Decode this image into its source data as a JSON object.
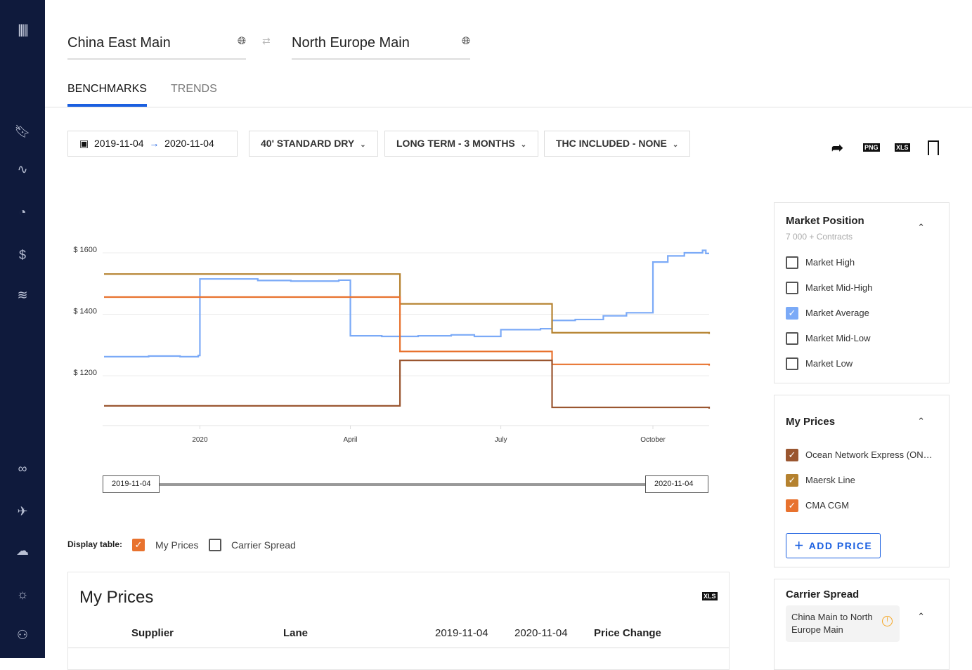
{
  "sidebar": {
    "icons": [
      "logo-icon",
      "bookmark-icon",
      "activity-icon",
      "speedometer-icon",
      "money-icon",
      "layers-icon",
      "incognito-icon",
      "plane-icon",
      "cloud-upload-icon",
      "lightbulb-icon",
      "user-icon"
    ]
  },
  "lanes": {
    "origin": "China East Main",
    "destination": "North Europe Main"
  },
  "tabs": [
    {
      "label": "BENCHMARKS",
      "active": true
    },
    {
      "label": "TRENDS",
      "active": false
    }
  ],
  "filters": {
    "date_from": "2019-11-04",
    "date_to": "2020-11-04",
    "container": "40' STANDARD DRY",
    "term": "LONG TERM - 3 MONTHS",
    "thc": "THC INCLUDED - NONE"
  },
  "tools": {
    "png": "PNG",
    "xls": "XLS"
  },
  "chart_data": {
    "type": "line",
    "step": true,
    "xlim": [
      "2019-11-04",
      "2020-11-04"
    ],
    "ylim": [
      1036,
      1640
    ],
    "yticks": [
      {
        "v": 1600,
        "label": "$ 1600"
      },
      {
        "v": 1400,
        "label": "$ 1400"
      },
      {
        "v": 1200,
        "label": "$ 1200"
      }
    ],
    "xticks": [
      {
        "d": "2020-01-01",
        "label": "2020"
      },
      {
        "d": "2020-04-01",
        "label": "April"
      },
      {
        "d": "2020-07-01",
        "label": "July"
      },
      {
        "d": "2020-10-01",
        "label": "October"
      }
    ],
    "grid": true,
    "series": [
      {
        "name": "Market Average",
        "color": "#7baaf7",
        "points": [
          [
            "2019-11-04",
            1262
          ],
          [
            "2019-12-01",
            1264
          ],
          [
            "2019-12-20",
            1262
          ],
          [
            "2019-12-31",
            1266
          ],
          [
            "2020-01-01",
            1515
          ],
          [
            "2020-02-05",
            1510
          ],
          [
            "2020-02-25",
            1508
          ],
          [
            "2020-03-25",
            1511
          ],
          [
            "2020-04-01",
            1330
          ],
          [
            "2020-04-20",
            1328
          ],
          [
            "2020-05-12",
            1330
          ],
          [
            "2020-06-01",
            1333
          ],
          [
            "2020-06-15",
            1328
          ],
          [
            "2020-07-01",
            1350
          ],
          [
            "2020-07-25",
            1353
          ],
          [
            "2020-08-01",
            1380
          ],
          [
            "2020-08-15",
            1383
          ],
          [
            "2020-09-01",
            1395
          ],
          [
            "2020-09-15",
            1405
          ],
          [
            "2020-10-01",
            1570
          ],
          [
            "2020-10-10",
            1590
          ],
          [
            "2020-10-20",
            1600
          ],
          [
            "2020-10-31",
            1608
          ],
          [
            "2020-11-02",
            1598
          ]
        ]
      },
      {
        "name": "Maersk Line",
        "color": "#b5822f",
        "points": [
          [
            "2019-11-04",
            1531
          ],
          [
            "2020-05-01",
            1434
          ],
          [
            "2020-08-01",
            1340
          ],
          [
            "2020-11-04",
            1336
          ]
        ]
      },
      {
        "name": "CMA CGM",
        "color": "#e8722e",
        "points": [
          [
            "2019-11-04",
            1456
          ],
          [
            "2020-05-01",
            1279
          ],
          [
            "2020-08-01",
            1237
          ],
          [
            "2020-11-04",
            1233
          ]
        ]
      },
      {
        "name": "Ocean Network Express (ONE)",
        "color": "#9a5630",
        "points": [
          [
            "2019-11-04",
            1102
          ],
          [
            "2020-05-01",
            1250
          ],
          [
            "2020-08-01",
            1097
          ],
          [
            "2020-11-04",
            1093
          ]
        ]
      }
    ]
  },
  "range_slider": {
    "start": "2019-11-04",
    "end": "2020-11-04"
  },
  "display_table": {
    "label": "Display table:",
    "options": [
      {
        "label": "My Prices",
        "checked": true
      },
      {
        "label": "Carrier Spread",
        "checked": false
      }
    ]
  },
  "table": {
    "title": "My Prices",
    "columns": [
      "Supplier",
      "Lane",
      "2019-11-04",
      "2020-11-04",
      "Price Change"
    ]
  },
  "market_position": {
    "title": "Market Position",
    "subtitle": "7 000 + Contracts",
    "items": [
      {
        "label": "Market High",
        "checked": false
      },
      {
        "label": "Market Mid-High",
        "checked": false
      },
      {
        "label": "Market Average",
        "checked": true
      },
      {
        "label": "Market Mid-Low",
        "checked": false
      },
      {
        "label": "Market Low",
        "checked": false
      }
    ]
  },
  "my_prices": {
    "title": "My Prices",
    "items": [
      {
        "label": "Ocean Network Express (ON…",
        "color": "#9a5630"
      },
      {
        "label": "Maersk Line",
        "color": "#b5822f"
      },
      {
        "label": "CMA CGM",
        "color": "#e8722e"
      }
    ],
    "add_label": "ADD PRICE"
  },
  "carrier_spread": {
    "title": "Carrier Spread",
    "lane": "China Main to North Europe Main"
  },
  "colors": {
    "accent": "#1a5fe0",
    "sidebar": "#0f1a3c",
    "checkbox": "#7baaf7",
    "warning": "#f5a623"
  }
}
